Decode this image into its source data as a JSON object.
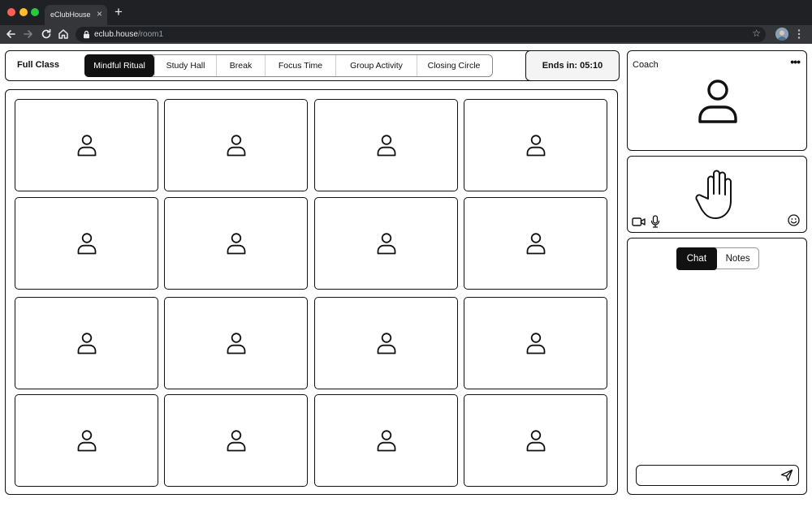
{
  "browser": {
    "tab_title": "eClubHouse",
    "tab_close": "×",
    "new_tab": "+",
    "url_host": "eclub.house",
    "url_path": "/room1",
    "bookmark_star": "☆"
  },
  "header": {
    "class_label": "Full Class",
    "tabs": [
      {
        "label": "Mindful Ritual",
        "active": true
      },
      {
        "label": "Study Hall",
        "active": false
      },
      {
        "label": "Break",
        "active": false
      },
      {
        "label": "Focus Time",
        "active": false
      },
      {
        "label": "Group Activity",
        "active": false
      },
      {
        "label": "Closing Circle",
        "active": false
      }
    ],
    "timer_label": "Ends in: 05:10"
  },
  "participants": {
    "rows": 4,
    "cols": 4,
    "icon": "user-icon"
  },
  "coach": {
    "label": "Coach",
    "more": "•••",
    "icon": "user-icon"
  },
  "self_view": {
    "hand_icon": "raised-hand-icon",
    "camera_icon": "video-camera-icon",
    "mic_icon": "microphone-icon",
    "emoji_icon": "smiley-icon"
  },
  "chat": {
    "tabs": [
      {
        "label": "Chat",
        "active": true
      },
      {
        "label": "Notes",
        "active": false
      }
    ],
    "input_placeholder": "",
    "send_icon": "send-icon"
  },
  "colors": {
    "chrome_dark": "#202124",
    "chrome_toolbar": "#35363a",
    "ink": "#111111",
    "timer_bg": "#f4f4f4"
  }
}
